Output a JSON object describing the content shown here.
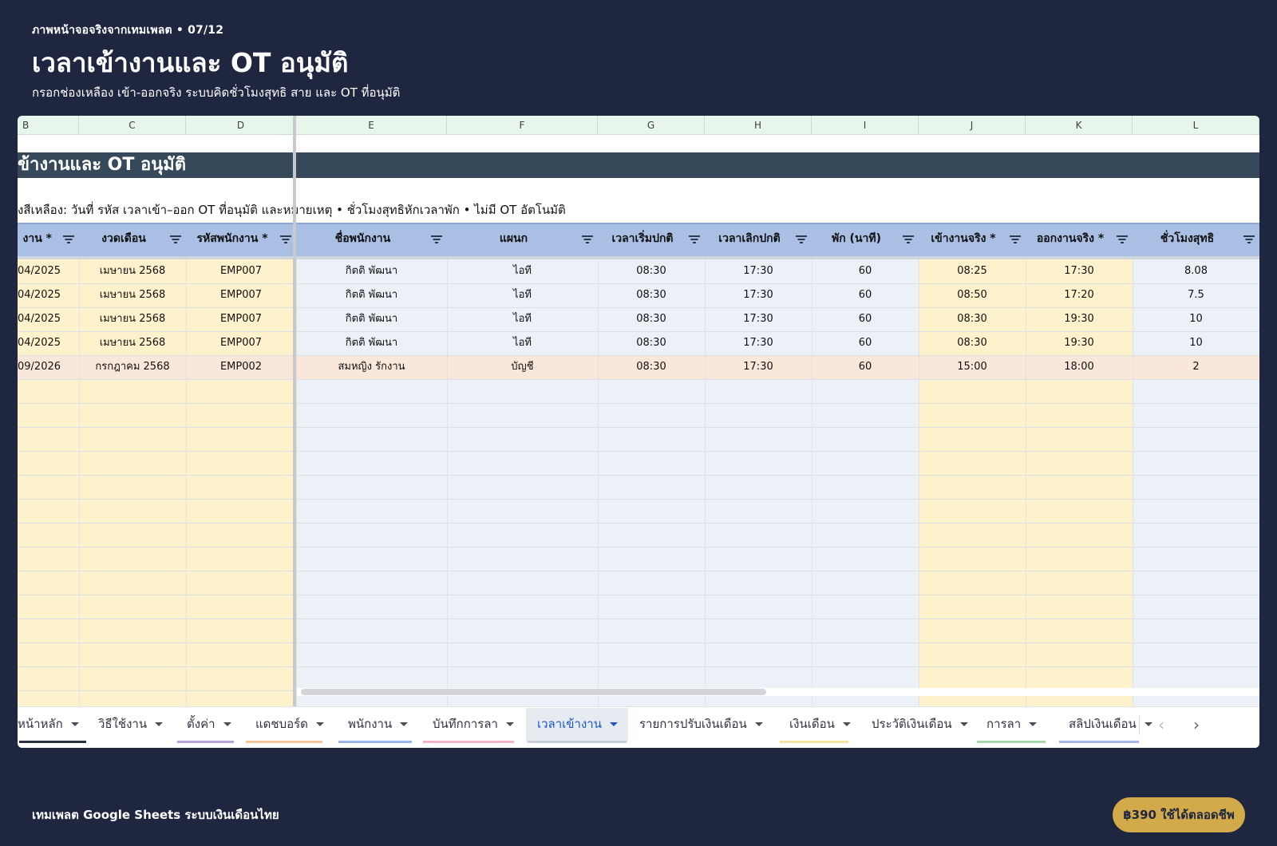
{
  "hero": {
    "kicker": "ภาพหน้าจอจริงจากเทมเพลต • 07/12",
    "title": "เวลาเข้างานและ OT อนุมัติ",
    "subtitle": "กรอกช่องเหลือง เข้า-ออกจริง ระบบคิดชั่วโมงสุทธิ สาย และ OT ที่อนุมัติ"
  },
  "sheet": {
    "column_letters": [
      "B",
      "C",
      "D",
      "E",
      "F",
      "G",
      "H",
      "I",
      "J",
      "K",
      "L"
    ],
    "title_band": "ข้างานและ OT อนุมัติ",
    "instructions": "งสีเหลือง: วันที่ รหัส เวลาเข้า–ออก OT ที่อนุมัติ และหมายเหตุ • ชั่วโมงสุทธิหักเวลาพัก • ไม่มี OT อัตโนมัติ",
    "headers": [
      "งาน *",
      "งวดเดือน",
      "รหัสพนักงาน *",
      "ชื่อพนักงาน",
      "แผนก",
      "เวลาเริ่มปกติ",
      "เวลาเลิกปกติ",
      "พัก (นาที)",
      "เข้างานจริง *",
      "ออกงานจริง *",
      "ชั่วโมงสุทธิ"
    ],
    "rows": [
      {
        "date": "04/2025",
        "period": "เมษายน 2568",
        "emp_id": "EMP007",
        "name": "กิตติ พัฒนา",
        "dept": "ไอที",
        "start": "08:30",
        "end": "17:30",
        "break": "60",
        "in": "08:25",
        "out": "17:30",
        "net": "8.08"
      },
      {
        "date": "04/2025",
        "period": "เมษายน 2568",
        "emp_id": "EMP007",
        "name": "กิตติ พัฒนา",
        "dept": "ไอที",
        "start": "08:30",
        "end": "17:30",
        "break": "60",
        "in": "08:50",
        "out": "17:20",
        "net": "7.5"
      },
      {
        "date": "04/2025",
        "period": "เมษายน 2568",
        "emp_id": "EMP007",
        "name": "กิตติ พัฒนา",
        "dept": "ไอที",
        "start": "08:30",
        "end": "17:30",
        "break": "60",
        "in": "08:30",
        "out": "19:30",
        "net": "10"
      },
      {
        "date": "04/2025",
        "period": "เมษายน 2568",
        "emp_id": "EMP007",
        "name": "กิตติ พัฒนา",
        "dept": "ไอที",
        "start": "08:30",
        "end": "17:30",
        "break": "60",
        "in": "08:30",
        "out": "19:30",
        "net": "10"
      },
      {
        "date": "09/2026",
        "period": "กรกฎาคม 2568",
        "emp_id": "EMP002",
        "name": "สมหญิง รักงาน",
        "dept": "บัญชี",
        "start": "08:30",
        "end": "17:30",
        "break": "60",
        "in": "15:00",
        "out": "18:00",
        "net": "2"
      }
    ]
  },
  "tabs": [
    {
      "label": "หน้าหลัก",
      "color": "#2b3342"
    },
    {
      "label": "วิธีใช้งาน",
      "color": ""
    },
    {
      "label": "ตั้งค่า",
      "color": "#b7a6d9"
    },
    {
      "label": "แดชบอร์ด",
      "color": "#f3c89b"
    },
    {
      "label": "พนักงาน",
      "color": "#9db6e6"
    },
    {
      "label": "บันทึกการลา",
      "color": "#f2b3c6"
    },
    {
      "label": "เวลาเข้างาน",
      "color": "#c9cfd8",
      "active": true
    },
    {
      "label": "รายการปรับเงินเดือน",
      "color": ""
    },
    {
      "label": "เงินเดือน",
      "color": "#f4e2a0"
    },
    {
      "label": "ประวัติเงินเดือน",
      "color": ""
    },
    {
      "label": "การลา",
      "color": "#a9d7b0"
    },
    {
      "label": "สลิปเงินเดือน",
      "color": "#a8b8e6"
    }
  ],
  "footer": {
    "left_text": "เทมเพลต Google Sheets ระบบเงินเดือนไทย",
    "price_button": "฿390 ใช้ได้ตลอดชีพ"
  }
}
